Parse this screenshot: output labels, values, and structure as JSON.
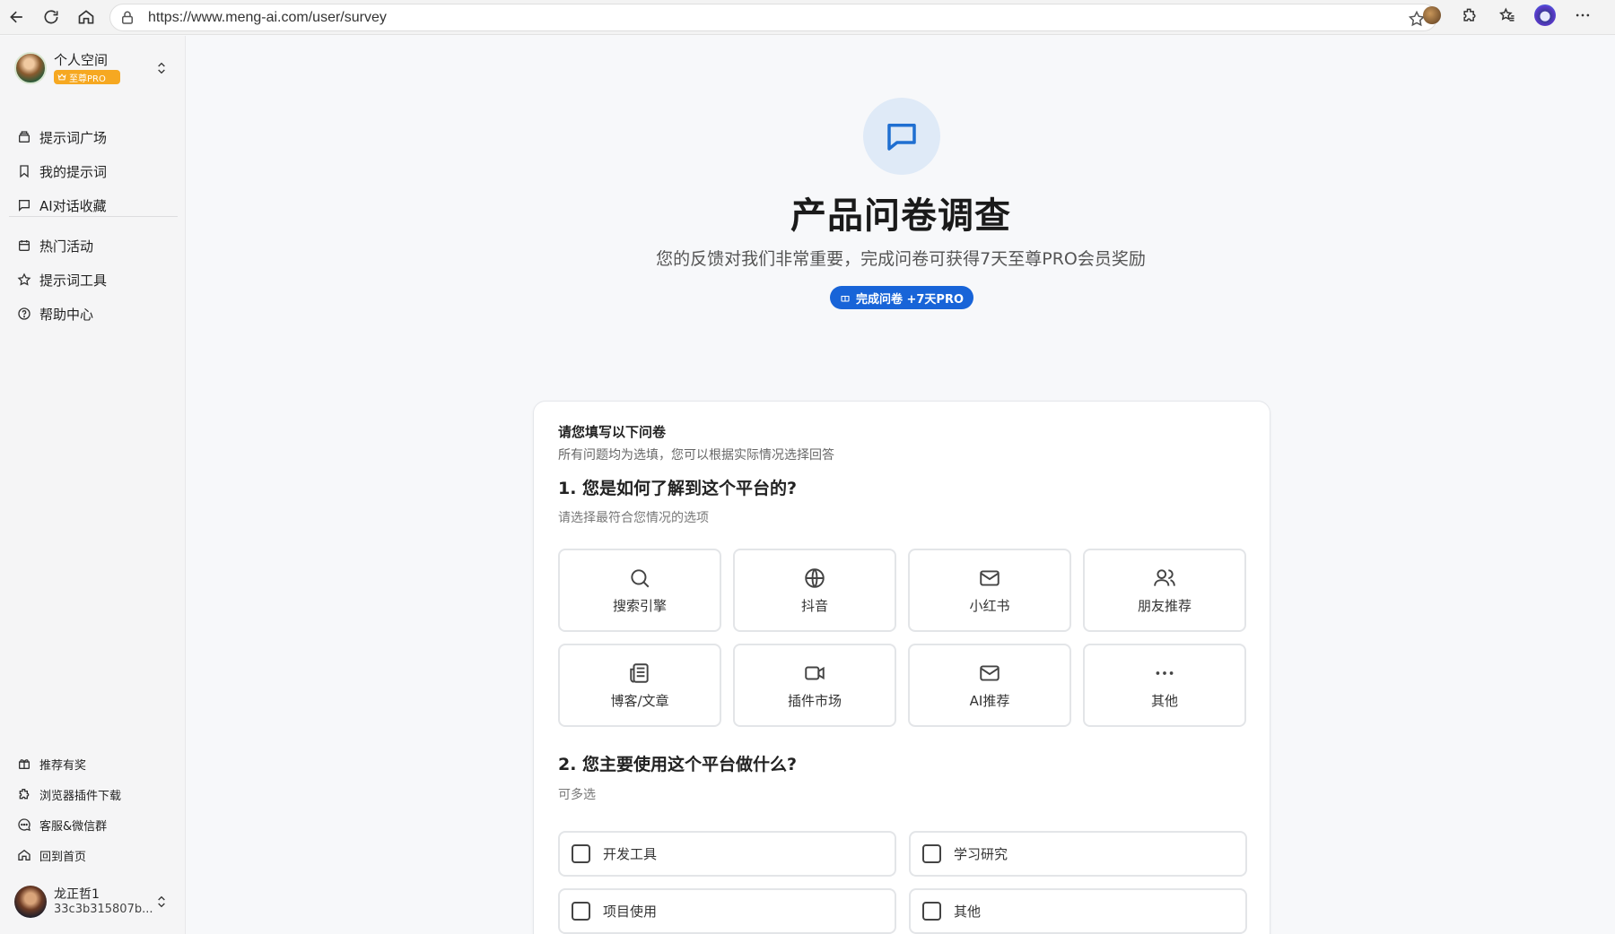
{
  "browser": {
    "url": "https://www.meng-ai.com/user/survey"
  },
  "sidebar": {
    "workspace_name": "个人空间",
    "workspace_badge": "至尊PRO",
    "items": [
      {
        "label": "提示词广场",
        "icon": "box-icon"
      },
      {
        "label": "我的提示词",
        "icon": "bookmark-icon"
      },
      {
        "label": "AI对话收藏",
        "icon": "chat-icon"
      },
      {
        "label": "热门活动",
        "icon": "calendar-icon"
      },
      {
        "label": "提示词工具",
        "icon": "star-icon"
      },
      {
        "label": "帮助中心",
        "icon": "help-icon"
      }
    ],
    "bottom_items": [
      {
        "label": "推荐有奖",
        "icon": "gift-icon"
      },
      {
        "label": "浏览器插件下载",
        "icon": "puzzle-icon"
      },
      {
        "label": "客服&微信群",
        "icon": "message-icon"
      },
      {
        "label": "回到首页",
        "icon": "home-icon"
      }
    ],
    "user": {
      "name": "龙正哲1",
      "id": "33c3b315807b..."
    }
  },
  "hero": {
    "icon": "message-square-icon",
    "title": "产品问卷调查",
    "subtitle": "您的反馈对我们非常重要，完成问卷可获得7天至尊PRO会员奖励",
    "reward": "完成问卷 +7天PRO"
  },
  "survey": {
    "header_title": "请您填写以下问卷",
    "header_desc": "所有问题均为选填，您可以根据实际情况选择回答",
    "q1": {
      "title": "1. 您是如何了解到这个平台的?",
      "hint": "请选择最符合您情况的选项",
      "options": [
        {
          "label": "搜索引擎",
          "icon": "search-icon"
        },
        {
          "label": "抖音",
          "icon": "globe-icon"
        },
        {
          "label": "小红书",
          "icon": "mail-icon"
        },
        {
          "label": "朋友推荐",
          "icon": "users-icon"
        },
        {
          "label": "博客/文章",
          "icon": "newspaper-icon"
        },
        {
          "label": "插件市场",
          "icon": "video-icon"
        },
        {
          "label": "AI推荐",
          "icon": "mail-icon"
        },
        {
          "label": "其他",
          "icon": "more-icon"
        }
      ]
    },
    "q2": {
      "title": "2. 您主要使用这个平台做什么?",
      "hint": "可多选",
      "options": [
        {
          "label": "开发工具",
          "checked": false
        },
        {
          "label": "学习研究",
          "checked": false
        },
        {
          "label": "项目使用",
          "checked": false
        },
        {
          "label": "其他",
          "checked": false
        }
      ]
    }
  }
}
